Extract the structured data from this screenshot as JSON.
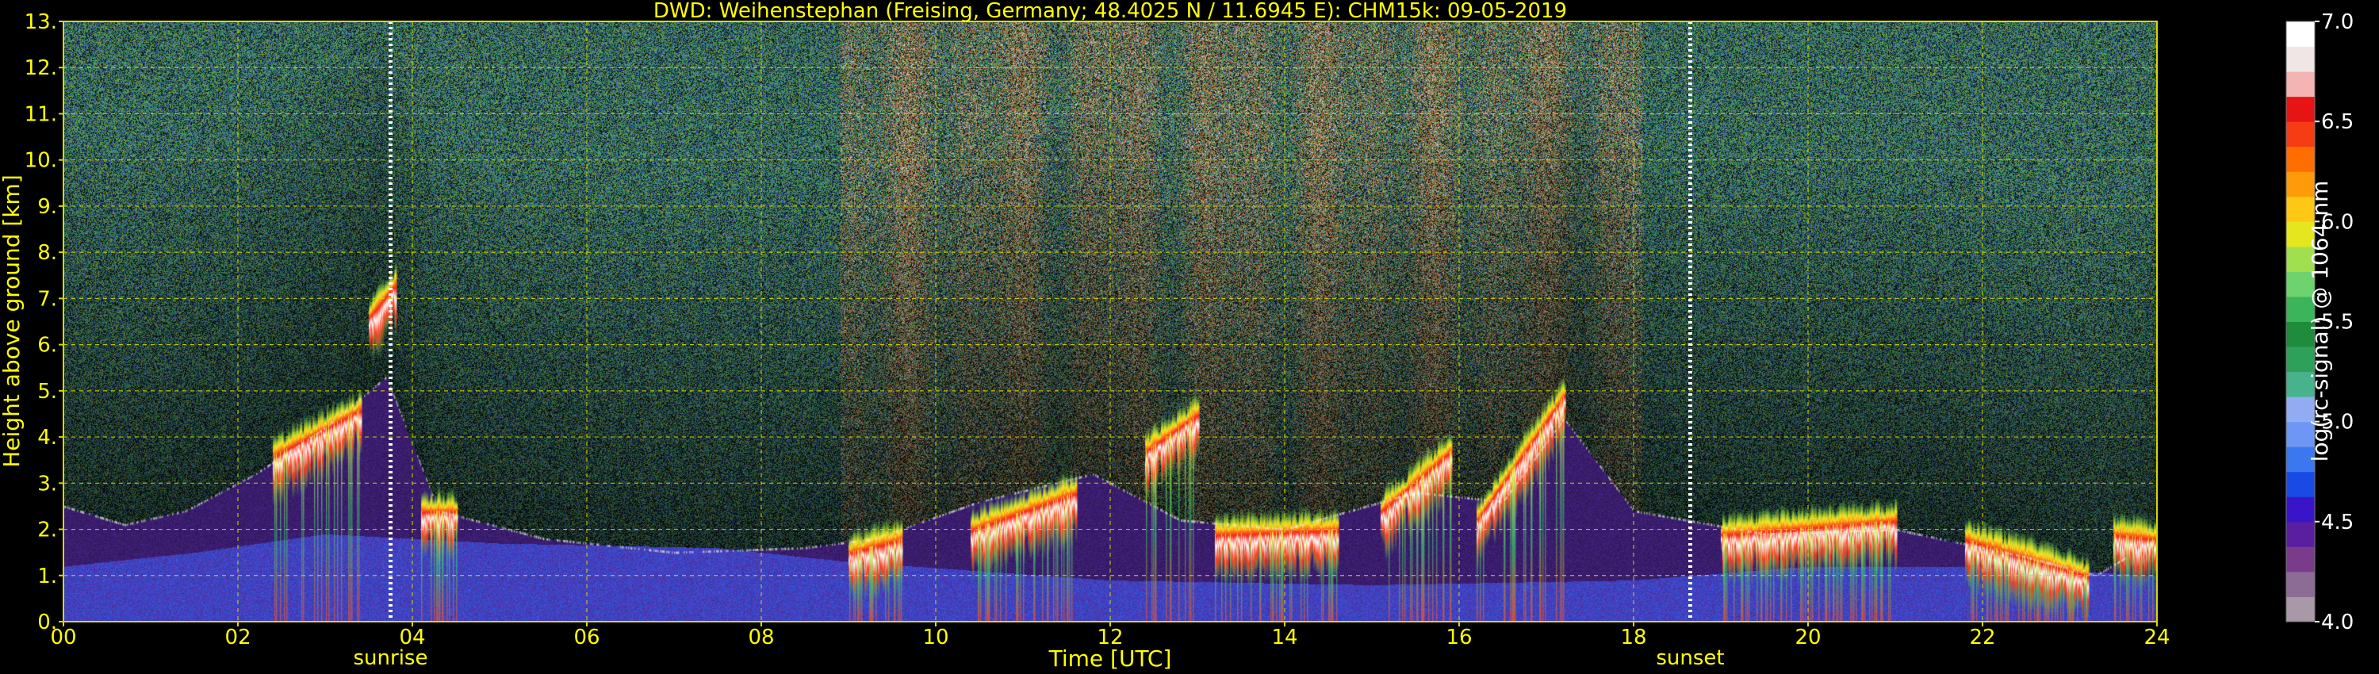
{
  "chart_data": {
    "type": "heatmap",
    "title": "DWD: Weihenstephan (Freising, Germany; 48.4025 N / 11.6945 E):    CHM15k: 09-05-2019",
    "xlabel": "Time [UTC]",
    "ylabel": "Height above ground [km]",
    "xlim": [
      0,
      24
    ],
    "ylim": [
      0,
      13
    ],
    "x_ticks": [
      "00",
      "02",
      "04",
      "06",
      "08",
      "10",
      "12",
      "14",
      "16",
      "18",
      "20",
      "22",
      "24"
    ],
    "y_ticks": [
      "0.",
      "1.",
      "2.",
      "3.",
      "4.",
      "5.",
      "6.",
      "7.",
      "8.",
      "9.",
      "10.",
      "11.",
      "12.",
      "13."
    ],
    "grid": true,
    "annotations": [
      {
        "label": "sunrise",
        "time": 3.75
      },
      {
        "label": "sunset",
        "time": 18.65
      }
    ],
    "colorbar": {
      "label": "log(rc-signal) @ 1064 nm",
      "range": [
        4.0,
        7.0
      ],
      "ticks": [
        "4.0",
        "4.5",
        "5.0",
        "5.5",
        "6.0",
        "6.5",
        "7.0"
      ],
      "colors": [
        "#a898a8",
        "#8c6c94",
        "#7a3c8a",
        "#5a1ea0",
        "#3a14c8",
        "#1a4ae6",
        "#3b78f0",
        "#6e96f4",
        "#92acf4",
        "#48b28c",
        "#2ea05a",
        "#1e8c3c",
        "#3cb45a",
        "#6ed26e",
        "#a0e050",
        "#e6e61e",
        "#ffc814",
        "#ff9b0a",
        "#ff6e00",
        "#f53c14",
        "#e61414",
        "#f5b4b4",
        "#f0e6e6",
        "#ffffff"
      ]
    },
    "features": {
      "boundary_layer_top_km": [
        {
          "t": 0.0,
          "h": 2.5
        },
        {
          "t": 0.7,
          "h": 2.1
        },
        {
          "t": 1.4,
          "h": 2.4
        },
        {
          "t": 2.2,
          "h": 3.2
        },
        {
          "t": 3.0,
          "h": 4.2
        },
        {
          "t": 3.7,
          "h": 5.3
        },
        {
          "t": 4.3,
          "h": 2.4
        },
        {
          "t": 5.5,
          "h": 1.8
        },
        {
          "t": 7.0,
          "h": 1.5
        },
        {
          "t": 8.5,
          "h": 1.6
        },
        {
          "t": 9.3,
          "h": 1.8
        },
        {
          "t": 10.5,
          "h": 2.6
        },
        {
          "t": 11.8,
          "h": 3.2
        },
        {
          "t": 12.8,
          "h": 2.2
        },
        {
          "t": 14.0,
          "h": 2.0
        },
        {
          "t": 15.5,
          "h": 2.8
        },
        {
          "t": 16.5,
          "h": 2.6
        },
        {
          "t": 17.2,
          "h": 4.4
        },
        {
          "t": 18.0,
          "h": 2.4
        },
        {
          "t": 19.5,
          "h": 1.9
        },
        {
          "t": 21.0,
          "h": 2.0
        },
        {
          "t": 22.5,
          "h": 1.4
        },
        {
          "t": 23.3,
          "h": 1.0
        },
        {
          "t": 24.0,
          "h": 1.8
        }
      ],
      "surface_layer_top_km": [
        {
          "t": 0.0,
          "h": 1.2
        },
        {
          "t": 1.5,
          "h": 1.5
        },
        {
          "t": 3.0,
          "h": 1.9
        },
        {
          "t": 5.0,
          "h": 1.7
        },
        {
          "t": 7.5,
          "h": 1.6
        },
        {
          "t": 9.0,
          "h": 1.3
        },
        {
          "t": 12.0,
          "h": 0.9
        },
        {
          "t": 15.0,
          "h": 0.8
        },
        {
          "t": 18.0,
          "h": 0.9
        },
        {
          "t": 20.0,
          "h": 1.2
        },
        {
          "t": 22.0,
          "h": 1.2
        },
        {
          "t": 24.0,
          "h": 1.0
        }
      ],
      "cloud_base_segments": [
        {
          "t0": 2.4,
          "t1": 3.4,
          "h0": 3.6,
          "h1": 4.6
        },
        {
          "t0": 3.5,
          "t1": 3.8,
          "h0": 6.6,
          "h1": 7.3
        },
        {
          "t0": 4.1,
          "t1": 4.5,
          "h0": 2.4,
          "h1": 2.4
        },
        {
          "t0": 9.0,
          "t1": 9.6,
          "h0": 1.5,
          "h1": 1.8
        },
        {
          "t0": 10.4,
          "t1": 11.6,
          "h0": 2.0,
          "h1": 2.8
        },
        {
          "t0": 12.4,
          "t1": 13.0,
          "h0": 3.7,
          "h1": 4.5
        },
        {
          "t0": 13.2,
          "t1": 14.6,
          "h0": 1.9,
          "h1": 2.0
        },
        {
          "t0": 15.1,
          "t1": 15.9,
          "h0": 2.4,
          "h1": 3.7
        },
        {
          "t0": 16.2,
          "t1": 17.2,
          "h0": 2.2,
          "h1": 4.9
        },
        {
          "t0": 19.0,
          "t1": 21.0,
          "h0": 1.9,
          "h1": 2.2
        },
        {
          "t0": 21.8,
          "t1": 23.2,
          "h0": 1.8,
          "h1": 1.0
        },
        {
          "t0": 23.5,
          "t1": 24.0,
          "h0": 1.9,
          "h1": 1.8
        }
      ]
    }
  },
  "colors": {
    "label_text": "#ffff00",
    "grid": "#d8d800",
    "sun_marker": "#ffffff",
    "background": "#000000"
  }
}
